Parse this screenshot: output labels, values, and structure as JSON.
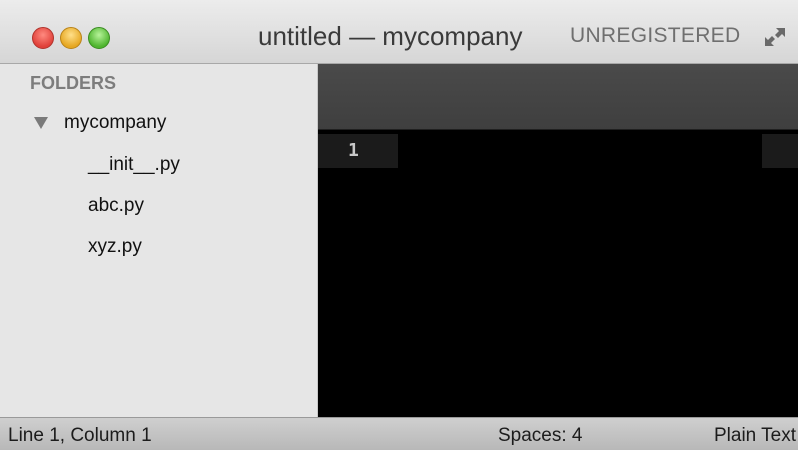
{
  "window": {
    "title": "untitled — mycompany",
    "unregistered": "UNREGISTERED",
    "icons": {
      "close": "close-button-icon",
      "minimize": "minimize-button-icon",
      "zoom": "zoom-button-icon",
      "fullscreen": "fullscreen-icon"
    },
    "colors": {
      "close": "#e0413a",
      "minimize": "#e6a722",
      "zoom": "#4fb52f"
    }
  },
  "sidebar": {
    "header": "FOLDERS",
    "folder": {
      "name": "mycompany",
      "expanded": true,
      "icon": "disclosure-triangle-icon"
    },
    "files": [
      "__init__.py",
      "abc.py",
      "xyz.py"
    ]
  },
  "editor": {
    "line_numbers": [
      "1"
    ],
    "background": "#000000"
  },
  "statusbar": {
    "position": "Line 1, Column 1",
    "spaces": "Spaces: 4",
    "syntax": "Plain Text"
  }
}
